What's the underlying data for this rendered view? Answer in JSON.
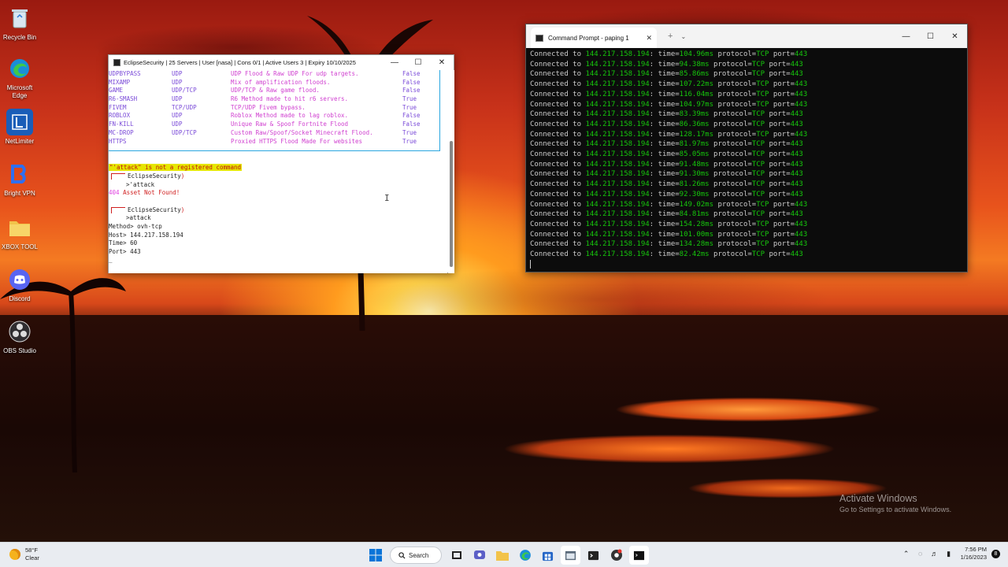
{
  "desktop": {
    "icons": [
      {
        "label": "Recycle Bin",
        "icon": "recycle-bin-icon"
      },
      {
        "label": "Microsoft Edge",
        "icon": "edge-icon"
      },
      {
        "label": "NetLimiter",
        "icon": "netlimiter-icon"
      },
      {
        "label": "Bright VPN",
        "icon": "bright-vpn-icon"
      },
      {
        "label": "XBOX TOOL",
        "icon": "folder-icon"
      },
      {
        "label": "Discord",
        "icon": "discord-icon"
      },
      {
        "label": "OBS Studio",
        "icon": "obs-icon"
      }
    ]
  },
  "eclipse_window": {
    "title": "EclipseSecurity | 25 Servers | User [nasa] | Cons 0/1 | Active Users 3 | Expiry 10/10/2025",
    "methods": [
      {
        "name": "UDPBYPASS",
        "protocol": "UDP",
        "description": "UDP Flood & Raw UDP For udp targets.",
        "vip": "False"
      },
      {
        "name": "MIXAMP",
        "protocol": "UDP",
        "description": "Mix of amplification floods.",
        "vip": "False"
      },
      {
        "name": "GAME",
        "protocol": "UDP/TCP",
        "description": "UDP/TCP & Raw game flood.",
        "vip": "False"
      },
      {
        "name": "R6-SMASH",
        "protocol": "UDP",
        "description": "R6 Method made to hit r6 servers.",
        "vip": "True"
      },
      {
        "name": "FIVEM",
        "protocol": "TCP/UDP",
        "description": "TCP/UDP Fivem bypass.",
        "vip": "True"
      },
      {
        "name": "ROBLOX",
        "protocol": "UDP",
        "description": "Roblox Method made to lag roblox.",
        "vip": "False"
      },
      {
        "name": "FN-KILL",
        "protocol": "UDP",
        "description": "Unique Raw & Spoof Fortnite Flood",
        "vip": "False"
      },
      {
        "name": "MC-DROP",
        "protocol": "UDP/TCP",
        "description": "Custom Raw/Spoof/Socket Minecraft Flood.",
        "vip": "True"
      },
      {
        "name": "HTTPS",
        "protocol": "",
        "description": "Proxied HTTPS Flood Made For websites",
        "vip": "True"
      }
    ],
    "terminal": {
      "error": "\"'attack\" is not a registered command",
      "prompt_name": "EclipseSecurity",
      "cmd1": ">'attack",
      "asset_msg_prefix": "404",
      "asset_msg": "Asset Not Found!",
      "cmd2": ">attack",
      "method_line": "Method> ovh-tcp",
      "host_line": "Host> 144.217.158.194",
      "time_line": "Time> 60",
      "port_line": "Port> 443",
      "cursor": "_"
    }
  },
  "cmd_window": {
    "tab_title": "Command Prompt - paping 1",
    "lines": [
      {
        "prefix": "Connected to",
        "ip": "144.217.158.194",
        "time": "104.96ms",
        "protocol": "TCP",
        "port": "443"
      },
      {
        "prefix": "Connected to",
        "ip": "144.217.158.194",
        "time": "94.38ms",
        "protocol": "TCP",
        "port": "443"
      },
      {
        "prefix": "Connected to",
        "ip": "144.217.158.194",
        "time": "85.86ms",
        "protocol": "TCP",
        "port": "443"
      },
      {
        "prefix": "Connected to",
        "ip": "144.217.158.194",
        "time": "107.22ms",
        "protocol": "TCP",
        "port": "443"
      },
      {
        "prefix": "Connected to",
        "ip": "144.217.158.194",
        "time": "116.04ms",
        "protocol": "TCP",
        "port": "443"
      },
      {
        "prefix": "Connected to",
        "ip": "144.217.158.194",
        "time": "104.97ms",
        "protocol": "TCP",
        "port": "443"
      },
      {
        "prefix": "Connected to",
        "ip": "144.217.158.194",
        "time": "83.39ms",
        "protocol": "TCP",
        "port": "443"
      },
      {
        "prefix": "Connected to",
        "ip": "144.217.158.194",
        "time": "86.36ms",
        "protocol": "TCP",
        "port": "443"
      },
      {
        "prefix": "Connected to",
        "ip": "144.217.158.194",
        "time": "128.17ms",
        "protocol": "TCP",
        "port": "443"
      },
      {
        "prefix": "Connected to",
        "ip": "144.217.158.194",
        "time": "81.97ms",
        "protocol": "TCP",
        "port": "443"
      },
      {
        "prefix": "Connected to",
        "ip": "144.217.158.194",
        "time": "85.05ms",
        "protocol": "TCP",
        "port": "443"
      },
      {
        "prefix": "Connected to",
        "ip": "144.217.158.194",
        "time": "91.48ms",
        "protocol": "TCP",
        "port": "443"
      },
      {
        "prefix": "Connected to",
        "ip": "144.217.158.194",
        "time": "91.30ms",
        "protocol": "TCP",
        "port": "443"
      },
      {
        "prefix": "Connected to",
        "ip": "144.217.158.194",
        "time": "81.26ms",
        "protocol": "TCP",
        "port": "443"
      },
      {
        "prefix": "Connected to",
        "ip": "144.217.158.194",
        "time": "92.30ms",
        "protocol": "TCP",
        "port": "443"
      },
      {
        "prefix": "Connected to",
        "ip": "144.217.158.194",
        "time": "149.02ms",
        "protocol": "TCP",
        "port": "443"
      },
      {
        "prefix": "Connected to",
        "ip": "144.217.158.194",
        "time": "84.81ms",
        "protocol": "TCP",
        "port": "443"
      },
      {
        "prefix": "Connected to",
        "ip": "144.217.158.194",
        "time": "154.28ms",
        "protocol": "TCP",
        "port": "443"
      },
      {
        "prefix": "Connected to",
        "ip": "144.217.158.194",
        "time": "101.00ms",
        "protocol": "TCP",
        "port": "443"
      },
      {
        "prefix": "Connected to",
        "ip": "144.217.158.194",
        "time": "134.28ms",
        "protocol": "TCP",
        "port": "443"
      },
      {
        "prefix": "Connected to",
        "ip": "144.217.158.194",
        "time": "82.42ms",
        "protocol": "TCP",
        "port": "443"
      }
    ]
  },
  "watermark": {
    "line1": "Activate Windows",
    "line2": "Go to Settings to activate Windows."
  },
  "taskbar": {
    "weather_temp": "58°F",
    "weather_desc": "Clear",
    "search_label": "Search",
    "time": "7:56 PM",
    "date": "1/16/2023",
    "notification_count": "8"
  },
  "colors": {
    "cmd_green": "#16c60c",
    "eclipse_purple": "#7a4ad8",
    "eclipse_pink": "#d040d0",
    "error_yellow": "#e6e600"
  }
}
